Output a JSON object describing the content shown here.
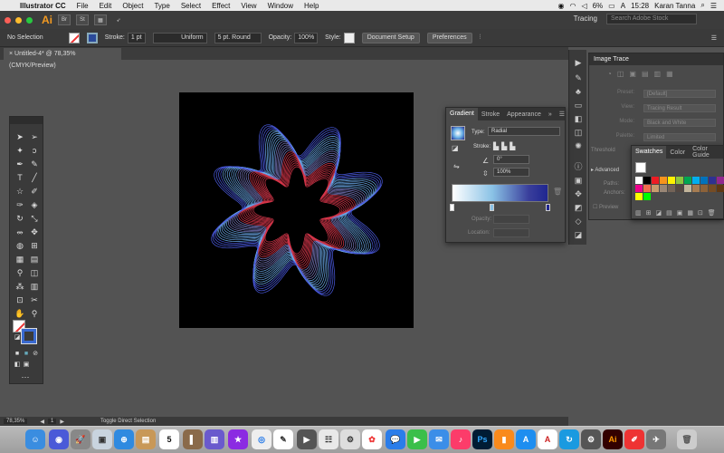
{
  "menubar": {
    "app_name": "Illustrator CC",
    "menus": [
      "File",
      "Edit",
      "Object",
      "Type",
      "Select",
      "Effect",
      "View",
      "Window",
      "Help"
    ],
    "battery": "6%",
    "time": "15:28",
    "user": "Karan Tanna"
  },
  "appbar": {
    "logo": "Ai",
    "app_icons": [
      "Br",
      "St"
    ],
    "workspace": "Tracing",
    "stock_placeholder": "Search Adobe Stock"
  },
  "controlbar": {
    "selection": "No Selection",
    "stroke_label": "Stroke:",
    "stroke_value": "1 pt",
    "profile": "Uniform",
    "brush": "5 pt. Round",
    "opacity_label": "Opacity:",
    "opacity_value": "100%",
    "style_label": "Style:",
    "document_setup": "Document Setup",
    "preferences": "Preferences"
  },
  "document": {
    "tab_title": "Untitled-4* @ 78,35% (CMYK/Preview)"
  },
  "image_trace": {
    "title": "Image Trace",
    "rows": [
      {
        "label": "Preset:",
        "value": "[Default]"
      },
      {
        "label": "View:",
        "value": "Tracing Result"
      },
      {
        "label": "Mode:",
        "value": "Black and White"
      },
      {
        "label": "Palette:",
        "value": "Limited"
      }
    ],
    "threshold": "Threshold",
    "advanced": "Advanced",
    "paths": "Paths:",
    "anchors": "Anchors:",
    "preview": "Preview"
  },
  "gradient": {
    "tabs": [
      "Gradient",
      "Stroke",
      "Appearance"
    ],
    "type_label": "Type:",
    "type_value": "Radial",
    "stroke_label": "Stroke:",
    "angle": "0°",
    "aspect": "100%",
    "opacity_label": "Opacity:",
    "location_label": "Location:"
  },
  "swatches": {
    "tabs": [
      "Swatches",
      "Color",
      "Color Guide"
    ],
    "colors": [
      "#ffffff",
      "#000000",
      "#ed1c24",
      "#f7941d",
      "#fff200",
      "#8dc63f",
      "#00a651",
      "#00aeef",
      "#0072bc",
      "#2e3192",
      "#92278f",
      "#ec008c",
      "#f26c4f",
      "#c69c6d",
      "#998675",
      "#736357",
      "#534741",
      "#c2b59b",
      "#a67c52",
      "#8c6239",
      "#754c24",
      "#603813",
      "#ffff00",
      "#00ff00"
    ]
  },
  "statusbar": {
    "zoom": "78,35%",
    "page": "1",
    "tool": "Toggle Direct Selection"
  },
  "dock": {
    "calendar_day": "5",
    "ps": "Ps",
    "ai": "Ai"
  }
}
